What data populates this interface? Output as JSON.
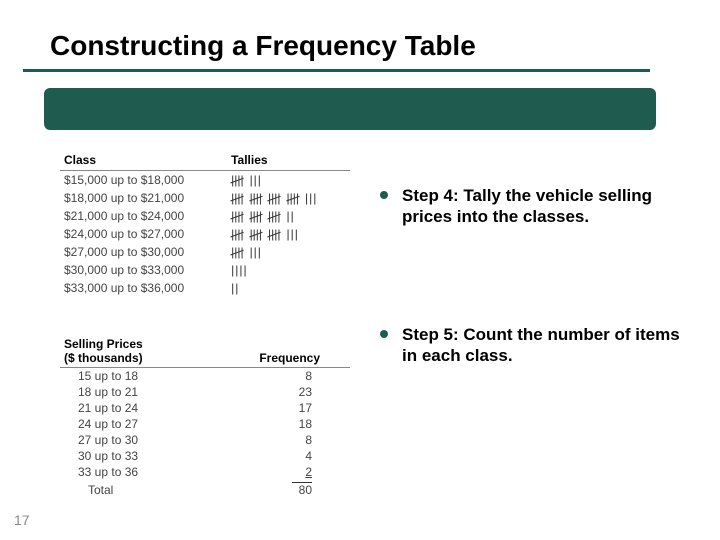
{
  "title": "Constructing a Frequency Table",
  "page_number": "17",
  "table1": {
    "headers": {
      "class": "Class",
      "tallies": "Tallies"
    },
    "rows": [
      {
        "range": "$15,000 up to $18,000",
        "tally_groups": 1,
        "tally_loose": 3
      },
      {
        "range": "$18,000 up to $21,000",
        "tally_groups": 4,
        "tally_loose": 3
      },
      {
        "range": "$21,000 up to $24,000",
        "tally_groups": 3,
        "tally_loose": 2
      },
      {
        "range": "$24,000 up to $27,000",
        "tally_groups": 3,
        "tally_loose": 3
      },
      {
        "range": "$27,000 up to $30,000",
        "tally_groups": 1,
        "tally_loose": 3
      },
      {
        "range": "$30,000 up to $33,000",
        "tally_groups": 0,
        "tally_loose": 4
      },
      {
        "range": "$33,000 up to $36,000",
        "tally_groups": 0,
        "tally_loose": 2
      }
    ]
  },
  "table2": {
    "headers": {
      "class": "Selling Prices\n($ thousands)",
      "freq": "Frequency"
    },
    "rows": [
      {
        "range": "15 up to 18",
        "freq": "8"
      },
      {
        "range": "18 up to 21",
        "freq": "23"
      },
      {
        "range": "21 up to 24",
        "freq": "17"
      },
      {
        "range": "24 up to 27",
        "freq": "18"
      },
      {
        "range": "27 up to 30",
        "freq": "8"
      },
      {
        "range": "30 up to 33",
        "freq": "4"
      },
      {
        "range": "33 up to 36",
        "freq": "2"
      }
    ],
    "total_label": "Total",
    "total_value": "80"
  },
  "bullets": [
    "Step 4: Tally the vehicle selling prices into the classes.",
    "Step 5: Count the number of items in each class."
  ]
}
